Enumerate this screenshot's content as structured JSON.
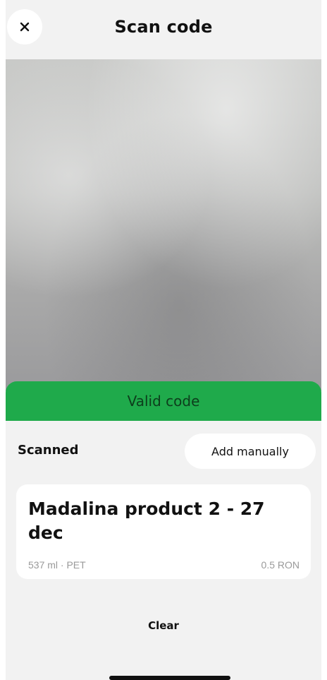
{
  "header": {
    "title": "Scan code",
    "close_icon": "close-icon"
  },
  "scanner": {
    "status_text": "Valid code",
    "status_color": "#1faa4b"
  },
  "scanned_section": {
    "label": "Scanned",
    "add_manually_label": "Add manually"
  },
  "product": {
    "name": "Madalina product 2 - 27 dec",
    "meta": "537 ml · PET",
    "price": "0.5 RON"
  },
  "actions": {
    "clear_label": "Clear"
  }
}
